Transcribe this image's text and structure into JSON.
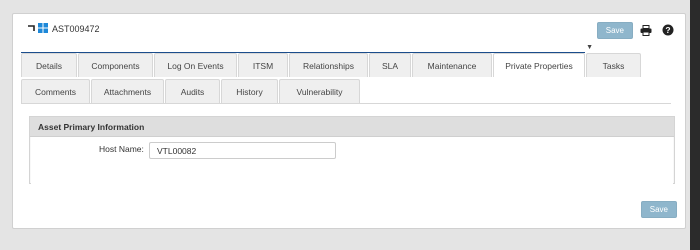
{
  "header": {
    "asset_id": "AST009472",
    "save_label": "Save"
  },
  "tabs_row1": [
    "Details",
    "Components",
    "Log On Events",
    "ITSM",
    "Relationships",
    "SLA",
    "Maintenance",
    "Private Properties",
    "Tasks"
  ],
  "tabs_row2": [
    "Comments",
    "Attachments",
    "Audits",
    "History",
    "Vulnerability"
  ],
  "active_tab": "Private Properties",
  "panel": {
    "title": "Asset Primary Information",
    "host_name_label": "Host Name:",
    "host_name_value": "VTL00082"
  },
  "footer": {
    "save_label": "Save"
  },
  "colors": {
    "accent": "#1b4d8c",
    "save_button": "#8fb6cc",
    "windows_blue": "#1e88d8"
  },
  "icons": [
    "link-icon",
    "windows-icon",
    "print-icon",
    "help-icon",
    "chevron-down-icon"
  ]
}
